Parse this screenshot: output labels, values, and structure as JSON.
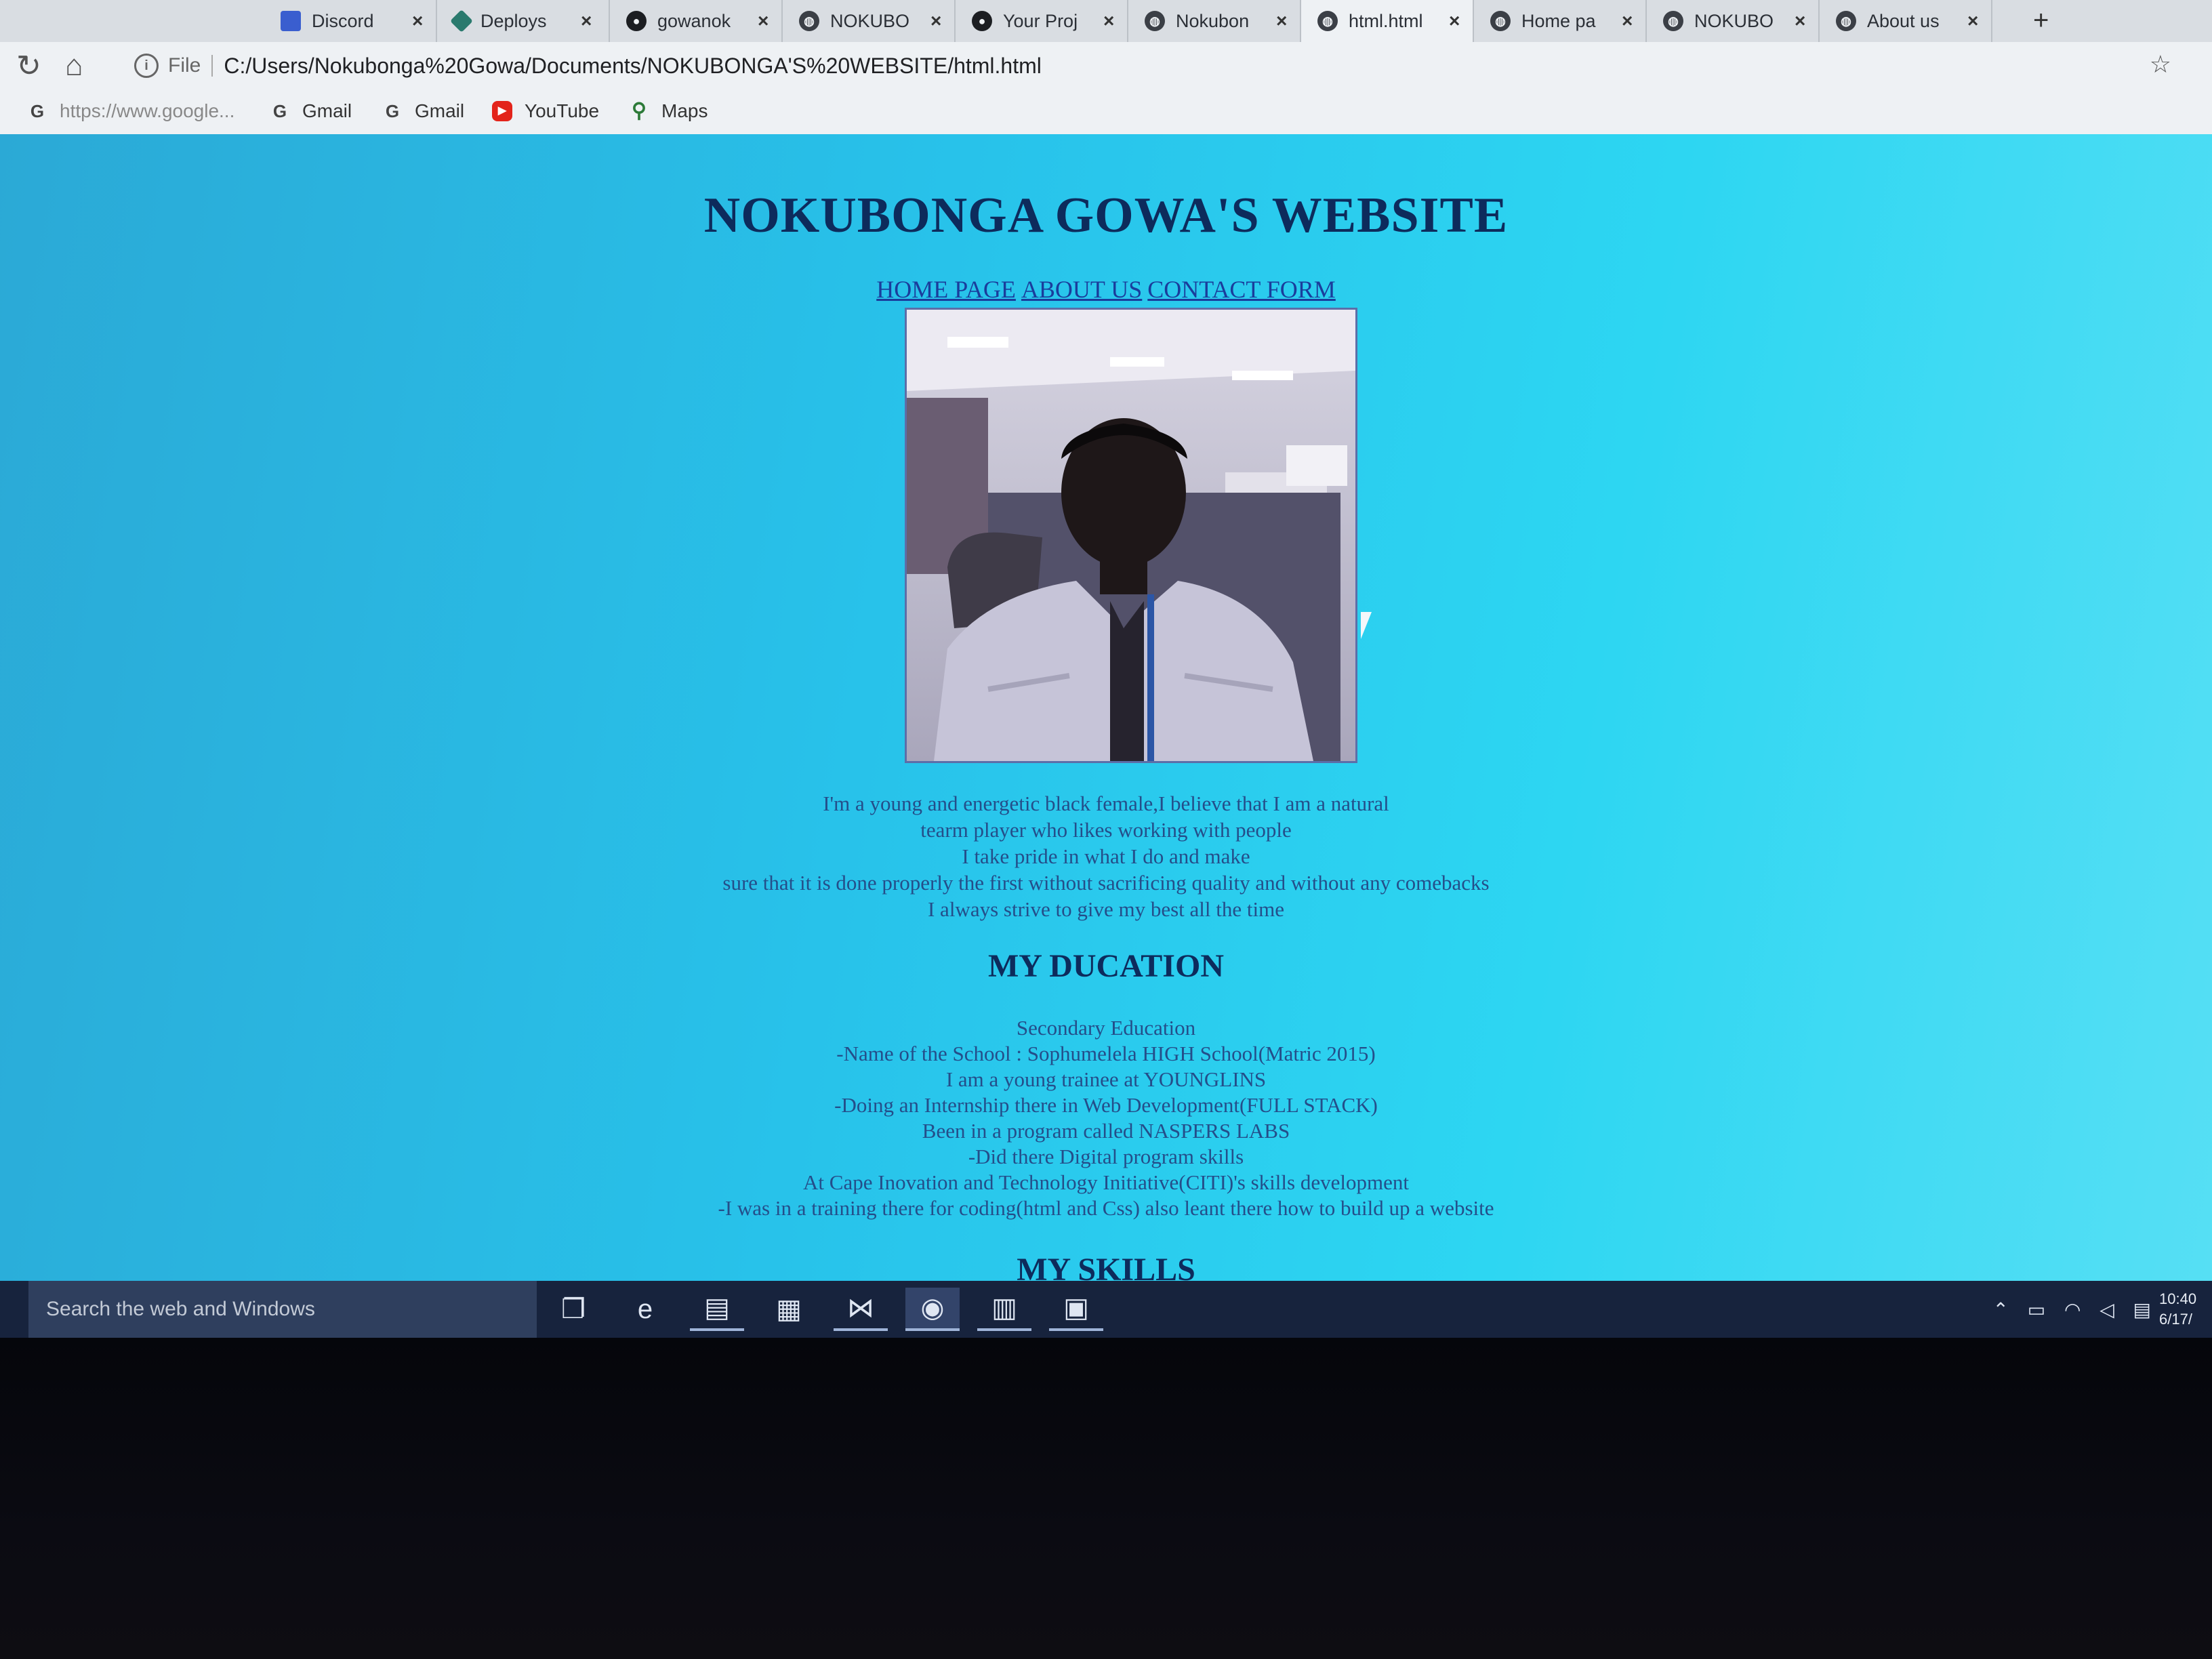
{
  "browser": {
    "tabs": [
      {
        "label": "Discord",
        "favicon": "discord-icon",
        "active": false
      },
      {
        "label": "Deploys",
        "favicon": "deploys-icon",
        "active": false
      },
      {
        "label": "gowanok",
        "favicon": "github-icon",
        "active": false
      },
      {
        "label": "NOKUBO",
        "favicon": "globe-icon",
        "active": false
      },
      {
        "label": "Your Proj",
        "favicon": "github-icon",
        "active": false
      },
      {
        "label": "Nokubon",
        "favicon": "globe-icon",
        "active": false
      },
      {
        "label": "html.html",
        "favicon": "globe-icon",
        "active": true
      },
      {
        "label": "Home pa",
        "favicon": "globe-icon",
        "active": false
      },
      {
        "label": "NOKUBO",
        "favicon": "globe-icon",
        "active": false
      },
      {
        "label": "About us",
        "favicon": "globe-icon",
        "active": false
      }
    ],
    "tab_close_glyph": "×",
    "new_tab_glyph": "+",
    "omnibox": {
      "scheme_label": "File",
      "url": "C:/Users/Nokubonga%20Gowa/Documents/NOKUBONGA'S%20WEBSITE/html.html"
    },
    "bookmarks": [
      {
        "label": "https://www.google...",
        "icon": "google-icon"
      },
      {
        "label": "Gmail",
        "icon": "google-icon"
      },
      {
        "label": "Gmail",
        "icon": "google-icon"
      },
      {
        "label": "YouTube",
        "icon": "youtube-icon"
      },
      {
        "label": "Maps",
        "icon": "maps-pin-icon"
      }
    ]
  },
  "page": {
    "title": "NOKUBONGA GOWA'S WEBSITE",
    "nav": [
      "HOME PAGE",
      "ABOUT US",
      "CONTACT FORM"
    ],
    "bio_lines": [
      "I'm a young and energetic black female,I believe that I am a natural",
      "tearm player who likes working with people",
      "I take pride in what I do and make",
      "sure that it is done properly the first without sacrificing quality and without any comebacks",
      "I always strive to give my best all the time"
    ],
    "education_heading": "MY DUCATION",
    "education_lines": [
      "Secondary Education",
      "-Name of the School : Sophumelela HIGH School(Matric 2015)",
      "I am a young trainee at YOUNGLINS",
      "-Doing an Internship there in Web Development(FULL STACK)",
      "Been in a program called NASPERS LABS",
      "-Did there Digital program skills",
      "At Cape Inovation and Technology Initiative(CITI)'s skills development",
      "-I was in a training there for coding(html and Css) also leant there how to build up a website"
    ],
    "skills_heading": "MY SKILLS"
  },
  "taskbar": {
    "search_placeholder": "Search the web and Windows",
    "apps": [
      "task-view-icon",
      "edge-icon",
      "file-explorer-icon",
      "store-icon",
      "vscode-icon",
      "chrome-icon",
      "notepad-icon",
      "app-window-icon"
    ],
    "clock_time": "10:40",
    "clock_date": "6/17/"
  },
  "colors": {
    "page_background": "#2dc6ec",
    "heading": "#0d2b5c",
    "link": "#1a3d9c",
    "taskbar": "#17233d"
  }
}
